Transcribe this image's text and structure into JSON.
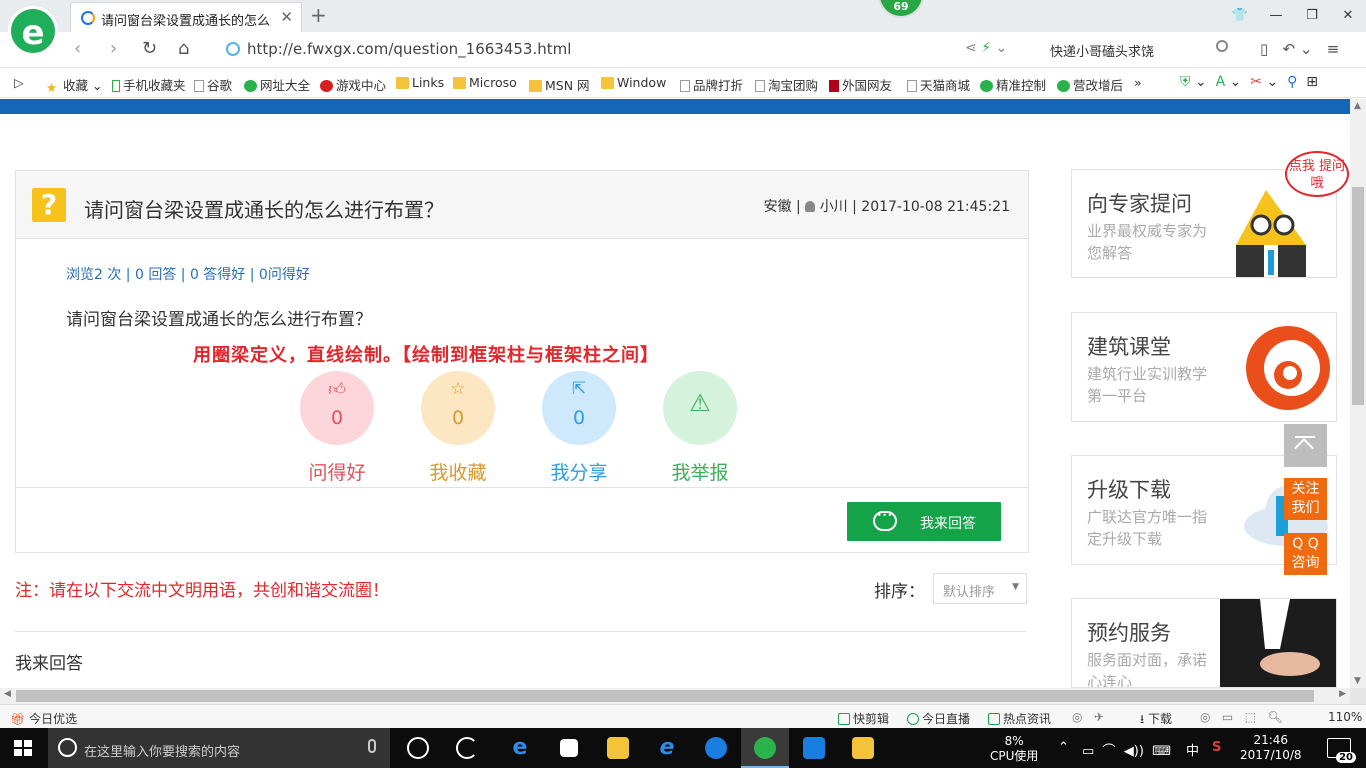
{
  "browser": {
    "tab_title": "请问窗台梁设置成通长的怎么进行布置？",
    "badge_count": "69",
    "url": "http://e.fwxgx.com/question_1663453.html",
    "search_box": "快递小哥磕头求饶",
    "logo_letter": "e"
  },
  "bookmarks": [
    {
      "label": "收藏",
      "icon": "star-icon"
    },
    {
      "label": "手机收藏夹",
      "icon": "phone-icon"
    },
    {
      "label": "谷歌",
      "icon": "page-icon"
    },
    {
      "label": "网址大全",
      "icon": "web-icon"
    },
    {
      "label": "游戏中心",
      "icon": "game-icon"
    },
    {
      "label": "Links",
      "icon": "folder-icon"
    },
    {
      "label": "Microso",
      "icon": "folder-icon"
    },
    {
      "label": "MSN 网",
      "icon": "folder-icon"
    },
    {
      "label": "Window",
      "icon": "folder-icon"
    },
    {
      "label": "品牌打折",
      "icon": "page-icon"
    },
    {
      "label": "淘宝团购",
      "icon": "page-icon"
    },
    {
      "label": "外国网友",
      "icon": "bookmark-icon"
    },
    {
      "label": "天猫商城",
      "icon": "page-icon"
    },
    {
      "label": "精准控制",
      "icon": "chat-icon"
    },
    {
      "label": "营改增后",
      "icon": "chat-icon"
    }
  ],
  "question": {
    "title": "请问窗台梁设置成通长的怎么进行布置？",
    "region": "安徽 |",
    "author": "小川",
    "timestamp": "| 2017-10-08 21:45:21",
    "stats": "浏览2 次 | 0 回答 | 0 答得好 | 0问得好",
    "body": "请问窗台梁设置成通长的怎么进行布置？",
    "highlight_answer": "用圈梁定义，直线绘制。【绘制到框架柱与框架柱之间】"
  },
  "actions": [
    {
      "label": "问得好",
      "count": "0",
      "icon": "thumbs-up-icon",
      "color": "#e5505e",
      "bg": "#fcd6da"
    },
    {
      "label": "我收藏",
      "count": "0",
      "icon": "star-icon",
      "color": "#d99a2b",
      "bg": "#fde6c2"
    },
    {
      "label": "我分享",
      "count": "0",
      "icon": "share-icon",
      "color": "#2e9ee0",
      "bg": "#cde9fb"
    },
    {
      "label": "我举报",
      "count": "",
      "icon": "warning-icon",
      "color": "#3bb05a",
      "bg": "#d5f2dc"
    }
  ],
  "answer_button": "我来回答",
  "notice": "注：请在以下交流中文明用语，共创和谐交流圈！",
  "sort": {
    "label": "排序：",
    "selected": "默认排序"
  },
  "my_answer": "我来回答",
  "sidebar": [
    {
      "title": "向专家提问",
      "sub": "业界最权威专家为您解答"
    },
    {
      "title": "建筑课堂",
      "sub": "建筑行业实训教学第一平台"
    },
    {
      "title": "升级下载",
      "sub": "广联达官方唯一指定升级下载"
    },
    {
      "title": "预约服务",
      "sub": "服务面对面，承诺心连心"
    }
  ],
  "bubble": "点我 提问哦",
  "float": {
    "follow": "关注 我们",
    "qq": "Q Q 咨询"
  },
  "statusbar": {
    "left": "今日优选",
    "items": [
      "快剪辑",
      "今日直播",
      "热点资讯",
      "下载"
    ],
    "zoom": "110%"
  },
  "taskbar": {
    "search_placeholder": "在这里输入你要搜索的内容",
    "cpu_pct": "8%",
    "cpu_label": "CPU使用",
    "ime": "中",
    "time": "21:46",
    "date": "2017/10/8",
    "notif_count": "20"
  }
}
